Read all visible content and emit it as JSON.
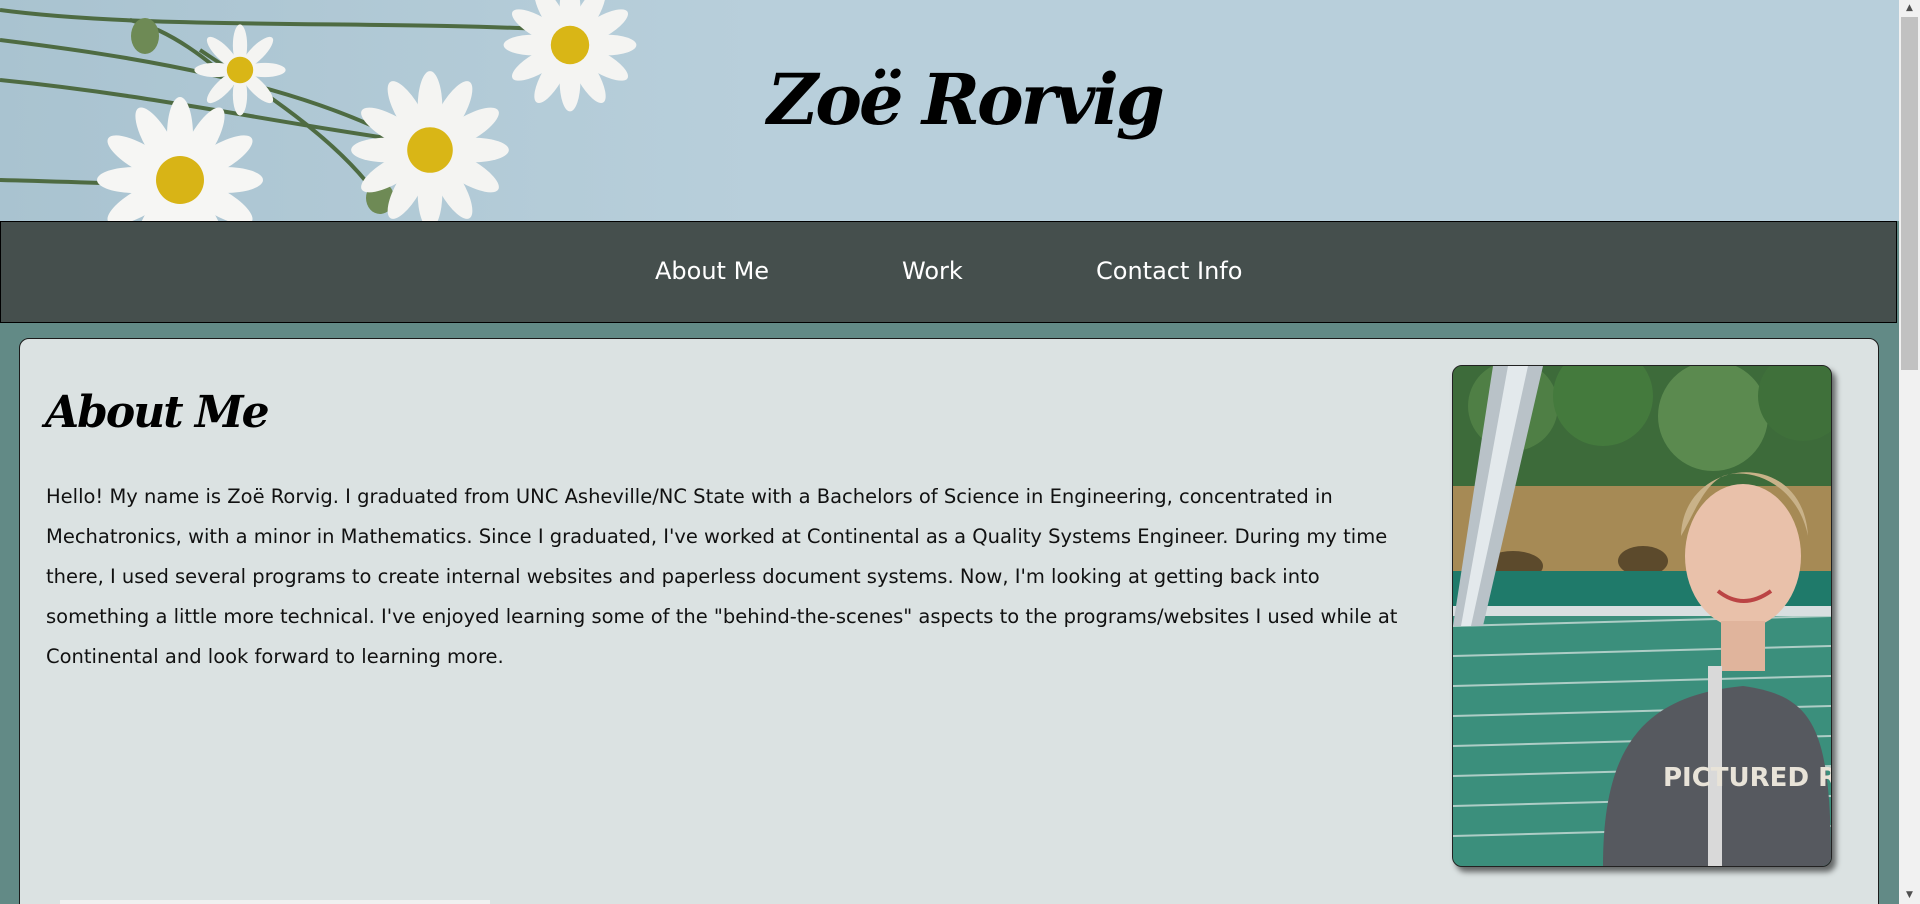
{
  "header": {
    "site_title": "Zoë Rorvig"
  },
  "nav": {
    "items": [
      {
        "label": "About Me"
      },
      {
        "label": "Work"
      },
      {
        "label": "Contact Info"
      }
    ]
  },
  "about": {
    "heading": "About Me",
    "paragraph": "Hello! My name is Zoë Rorvig. I graduated from UNC Asheville/NC State with a Bachelors of Science in Engineering, concentrated in Mechatronics, with a minor in Mathematics. Since I graduated, I've worked at Continental as a Quality Systems Engineer. During my time there, I used several programs to create internal websites and paperless document systems. Now, I'm looking at getting back into something a little more technical. I've enjoyed learning some of the \"behind-the-scenes\" aspects to the programs/websites I used while at Continental and look forward to learning more.",
    "photo_shirt_text": "PICTURED ROCKS"
  },
  "colors": {
    "page_background": "#628a86",
    "nav_background": "#454f4d",
    "card_background": "#dbe2e2",
    "banner_sky": "#b8cfdb"
  },
  "icons": {
    "scroll_up": "triangle-up-icon",
    "scroll_down": "triangle-down-icon"
  }
}
